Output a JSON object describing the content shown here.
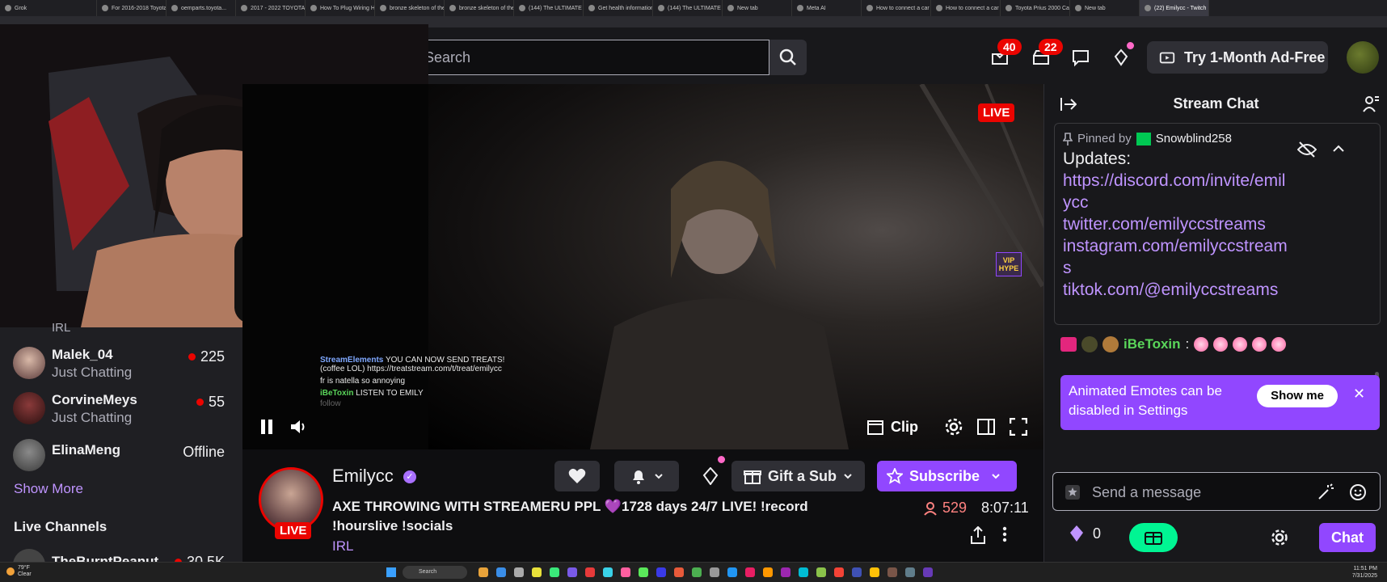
{
  "browser": {
    "tabs": [
      {
        "label": "Grok"
      },
      {
        "label": "For 2016-2018 Toyota P..."
      },
      {
        "label": "oemparts.toyota..."
      },
      {
        "label": "2017 - 2022 TOYOTA PR..."
      },
      {
        "label": "How To Plug Wiring Ha..."
      },
      {
        "label": "bronze skeleton of the hu..."
      },
      {
        "label": "bronze skeleton of the hu..."
      },
      {
        "label": "(144) The ULTIMATE Sc..."
      },
      {
        "label": "Get health information..."
      },
      {
        "label": "(144) The ULTIMATE Sc..."
      },
      {
        "label": "New tab"
      },
      {
        "label": "Meta AI"
      },
      {
        "label": "How to connect a car lig..."
      },
      {
        "label": "How to connect a car lig..."
      },
      {
        "label": "Toyota Prius 2000 Car R..."
      },
      {
        "label": "New tab"
      },
      {
        "label": "(22) Emilycc - Twitch"
      }
    ]
  },
  "header": {
    "search_placeholder": "Search",
    "notifications_count": "40",
    "inbox_count": "22",
    "adfree_label": "Try 1-Month Ad-Free"
  },
  "sidebar": {
    "channels": [
      {
        "name": "Malek_04",
        "category": "Just Chatting",
        "viewers": "225",
        "status": "live"
      },
      {
        "name": "CorvineMeys",
        "category": "Just Chatting",
        "viewers": "55",
        "status": "live"
      },
      {
        "name": "ElinaMeng",
        "category": "",
        "viewers": "Offline",
        "status": "offline"
      }
    ],
    "partial_category": "IRL",
    "show_more": "Show More",
    "live_heading": "Live Channels",
    "partial_channel": {
      "name": "TheBurntPeanut",
      "viewers": "30.5K"
    }
  },
  "player": {
    "live_label": "LIVE",
    "vip_label": "VIP HYPE",
    "clip_label": "Clip",
    "overlay_chat": [
      {
        "user": "StreamElements",
        "text": "YOU CAN NOW SEND TREATS! (coffee LOL) https://treatstream.com/t/treat/emilycc"
      },
      {
        "user": "",
        "text": "fr is natella so annoying"
      },
      {
        "user": "iBeToxin",
        "text": "LISTEN TO EMILY"
      },
      {
        "user": "",
        "text": "follow"
      }
    ]
  },
  "stream": {
    "streamer_name": "Emilycc",
    "live_label": "LIVE",
    "title": "AXE THROWING WITH STREAMERU PPL 💜1728 days 24/7 LIVE! !record !hourslive !socials",
    "category": "IRL",
    "gift_label": "Gift a Sub",
    "subscribe_label": "Subscribe",
    "viewers": "529",
    "uptime": "8:07:11"
  },
  "chat": {
    "title": "Stream Chat",
    "pinned_prefix": "Pinned by",
    "pinned_user": "Snowblind258",
    "pinned_heading": "Updates:",
    "pinned_links": [
      "https://discord.com/invite/emilycc",
      "twitter.com/emilyccstreams",
      "instagram.com/emilyccstreams",
      "tiktok.com/@emilyccstreams"
    ],
    "message": {
      "user": "iBeToxin",
      "separator": ":"
    },
    "promo_text": "Animated Emotes can be disabled in Settings",
    "promo_button": "Show me",
    "input_placeholder": "Send a message",
    "bits_count": "0",
    "chat_button": "Chat"
  },
  "taskbar": {
    "weather_temp": "79°F",
    "weather_desc": "Clear",
    "search_label": "Search",
    "time": "11:51 PM",
    "date": "7/31/2025"
  },
  "colors": {
    "accent": "#9147ff",
    "link": "#bf94ff",
    "live": "#eb0400",
    "prime": "#00f593"
  }
}
